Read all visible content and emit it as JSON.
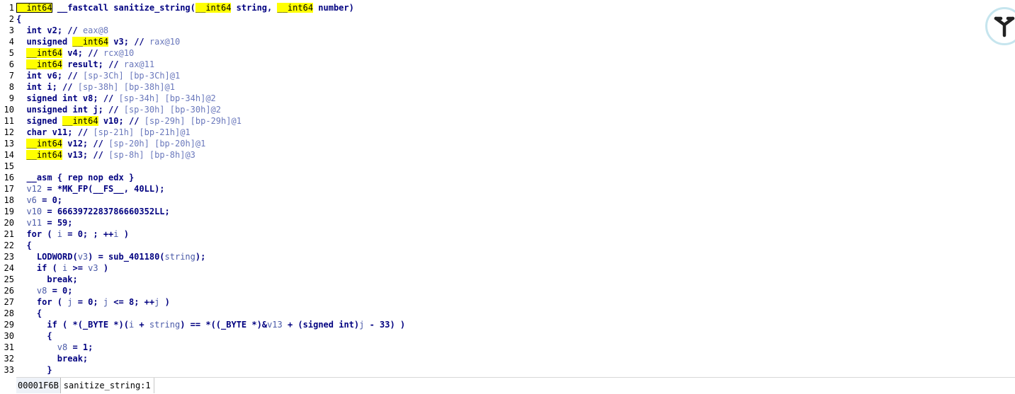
{
  "editor": {
    "line_numbers": [
      "1",
      "2",
      "3",
      "4",
      "5",
      "6",
      "7",
      "8",
      "9",
      "10",
      "11",
      "12",
      "13",
      "14",
      "15",
      "16",
      "17",
      "18",
      "19",
      "20",
      "21",
      "22",
      "23",
      "24",
      "25",
      "26",
      "27",
      "28",
      "29",
      "30",
      "31",
      "32",
      "33"
    ],
    "lines": [
      [
        [
          "hl",
          "__int64"
        ],
        [
          "p",
          " __fastcall sanitize_string("
        ],
        [
          "hl",
          "__int64"
        ],
        [
          "p",
          " string, "
        ],
        [
          "hl",
          "__int64"
        ],
        [
          "p",
          " number)"
        ]
      ],
      [
        [
          "p",
          "{"
        ]
      ],
      [
        [
          "p",
          "  "
        ],
        [
          "t",
          "int"
        ],
        [
          "p",
          " v2; "
        ],
        [
          "p",
          "// "
        ],
        [
          "c",
          "eax@8"
        ]
      ],
      [
        [
          "p",
          "  unsigned "
        ],
        [
          "hl",
          "__int64"
        ],
        [
          "p",
          " v3; "
        ],
        [
          "p",
          "// "
        ],
        [
          "c",
          "rax@10"
        ]
      ],
      [
        [
          "p",
          "  "
        ],
        [
          "hl",
          "__int64"
        ],
        [
          "p",
          " v4; "
        ],
        [
          "p",
          "// "
        ],
        [
          "c",
          "rcx@10"
        ]
      ],
      [
        [
          "p",
          "  "
        ],
        [
          "hl",
          "__int64"
        ],
        [
          "p",
          " result; "
        ],
        [
          "p",
          "// "
        ],
        [
          "c",
          "rax@11"
        ]
      ],
      [
        [
          "p",
          "  "
        ],
        [
          "t",
          "int"
        ],
        [
          "p",
          " v6; "
        ],
        [
          "p",
          "// "
        ],
        [
          "c",
          "[sp-3Ch] [bp-3Ch]@1"
        ]
      ],
      [
        [
          "p",
          "  "
        ],
        [
          "t",
          "int"
        ],
        [
          "p",
          " i; "
        ],
        [
          "p",
          "// "
        ],
        [
          "c",
          "[sp-38h] [bp-38h]@1"
        ]
      ],
      [
        [
          "p",
          "  signed int v8; "
        ],
        [
          "p",
          "// "
        ],
        [
          "c",
          "[sp-34h] [bp-34h]@2"
        ]
      ],
      [
        [
          "p",
          "  unsigned int j; "
        ],
        [
          "p",
          "// "
        ],
        [
          "c",
          "[sp-30h] [bp-30h]@2"
        ]
      ],
      [
        [
          "p",
          "  signed "
        ],
        [
          "hl",
          "__int64"
        ],
        [
          "p",
          " v10; "
        ],
        [
          "p",
          "// "
        ],
        [
          "c",
          "[sp-29h] [bp-29h]@1"
        ]
      ],
      [
        [
          "p",
          "  char v11; "
        ],
        [
          "p",
          "// "
        ],
        [
          "c",
          "[sp-21h] [bp-21h]@1"
        ]
      ],
      [
        [
          "p",
          "  "
        ],
        [
          "hl",
          "__int64"
        ],
        [
          "p",
          " v12; "
        ],
        [
          "p",
          "// "
        ],
        [
          "c",
          "[sp-20h] [bp-20h]@1"
        ]
      ],
      [
        [
          "p",
          "  "
        ],
        [
          "hl",
          "__int64"
        ],
        [
          "p",
          " v13; "
        ],
        [
          "p",
          "// "
        ],
        [
          "c",
          "[sp-8h] [bp-8h]@3"
        ]
      ],
      [],
      [
        [
          "p",
          "  __asm { rep nop edx }"
        ]
      ],
      [
        [
          "p",
          "  "
        ],
        [
          "v",
          "v12"
        ],
        [
          "p",
          " = *MK_FP(__FS__, 40LL);"
        ]
      ],
      [
        [
          "p",
          "  "
        ],
        [
          "v",
          "v6"
        ],
        [
          "p",
          " = 0;"
        ]
      ],
      [
        [
          "p",
          "  "
        ],
        [
          "v",
          "v10"
        ],
        [
          "p",
          " = 6663972283786660352LL;"
        ]
      ],
      [
        [
          "p",
          "  "
        ],
        [
          "v",
          "v11"
        ],
        [
          "p",
          " = 59;"
        ]
      ],
      [
        [
          "p",
          "  for ( "
        ],
        [
          "v",
          "i"
        ],
        [
          "p",
          " = 0; ; ++"
        ],
        [
          "v",
          "i"
        ],
        [
          "p",
          " )"
        ]
      ],
      [
        [
          "p",
          "  {"
        ]
      ],
      [
        [
          "p",
          "    LODWORD("
        ],
        [
          "v",
          "v3"
        ],
        [
          "p",
          ") = sub_401180("
        ],
        [
          "v",
          "string"
        ],
        [
          "p",
          ");"
        ]
      ],
      [
        [
          "p",
          "    if ( "
        ],
        [
          "v",
          "i"
        ],
        [
          "p",
          " >= "
        ],
        [
          "v",
          "v3"
        ],
        [
          "p",
          " )"
        ]
      ],
      [
        [
          "p",
          "      break;"
        ]
      ],
      [
        [
          "p",
          "    "
        ],
        [
          "v",
          "v8"
        ],
        [
          "p",
          " = 0;"
        ]
      ],
      [
        [
          "p",
          "    for ( "
        ],
        [
          "v",
          "j"
        ],
        [
          "p",
          " = 0; "
        ],
        [
          "v",
          "j"
        ],
        [
          "p",
          " <= 8; ++"
        ],
        [
          "v",
          "j"
        ],
        [
          "p",
          " )"
        ]
      ],
      [
        [
          "p",
          "    {"
        ]
      ],
      [
        [
          "p",
          "      if ( *(_BYTE *)("
        ],
        [
          "v",
          "i"
        ],
        [
          "p",
          " + "
        ],
        [
          "v",
          "string"
        ],
        [
          "p",
          ") == *((_BYTE *)&"
        ],
        [
          "v",
          "v13"
        ],
        [
          "p",
          " + (signed int)"
        ],
        [
          "v",
          "j"
        ],
        [
          "p",
          " - 33) )"
        ]
      ],
      [
        [
          "p",
          "      {"
        ]
      ],
      [
        [
          "p",
          "        "
        ],
        [
          "v",
          "v8"
        ],
        [
          "p",
          " = 1;"
        ]
      ],
      [
        [
          "p",
          "        break;"
        ]
      ],
      [
        [
          "p",
          "      }"
        ]
      ]
    ]
  },
  "status": {
    "address": "00001F6B",
    "location": "sanitize_string:1"
  },
  "logo": {
    "icon": "app-logo-icon"
  }
}
